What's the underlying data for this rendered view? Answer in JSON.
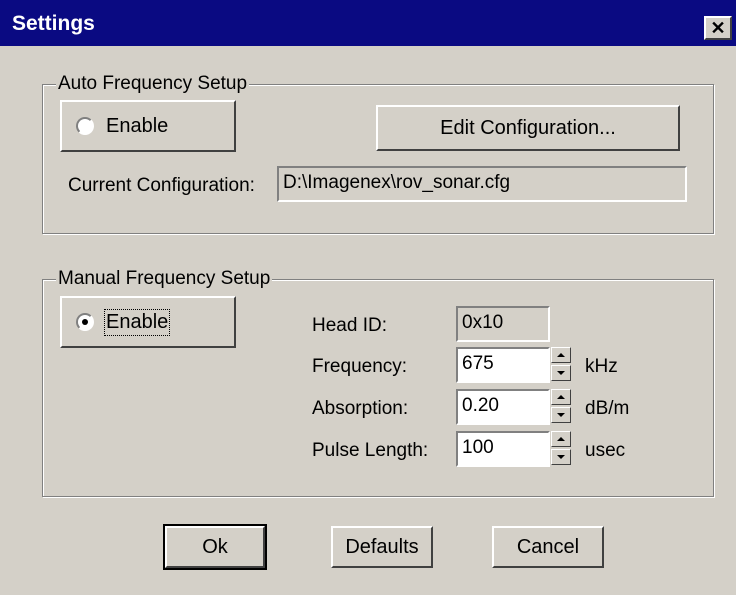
{
  "window": {
    "title": "Settings",
    "close_glyph": "✕"
  },
  "auto_setup": {
    "legend": "Auto Frequency Setup",
    "enable_label": "Enable",
    "enable_checked": false,
    "edit_button": "Edit Configuration...",
    "current_config_label": "Current Configuration:",
    "current_config_value": "D:\\Imagenex\\rov_sonar.cfg"
  },
  "manual_setup": {
    "legend": "Manual Frequency Setup",
    "enable_label": "Enable",
    "enable_checked": true,
    "head_id": {
      "label": "Head ID:",
      "value": "0x10"
    },
    "frequency": {
      "label": "Frequency:",
      "value": "675",
      "unit": "kHz"
    },
    "absorption": {
      "label": "Absorption:",
      "value": "0.20",
      "unit": "dB/m"
    },
    "pulse_length": {
      "label": "Pulse Length:",
      "value": "100",
      "unit": "usec"
    }
  },
  "buttons": {
    "ok": "Ok",
    "defaults": "Defaults",
    "cancel": "Cancel"
  },
  "colors": {
    "titlebar": "#0a0a82",
    "face": "#d4d0c8"
  }
}
